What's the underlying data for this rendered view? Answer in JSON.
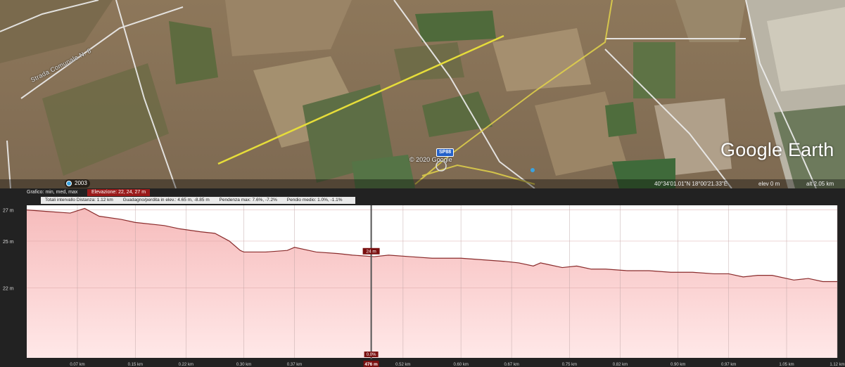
{
  "map": {
    "road_label": "Strada Comunale N. 8",
    "copyright": "© 2020 Google",
    "road_badge": "SP88",
    "brand": "Google Earth",
    "year_badge": "2003",
    "status": {
      "coords": "40°34'01.01\"N  18°00'21.33\"E",
      "elev": "elev    0 m",
      "alt": "alt  2.05 km"
    },
    "colors": {
      "path": "#e6dd3a",
      "roads": "#eeeeee"
    }
  },
  "profile": {
    "graph_label": "Grafico: min, med, max",
    "elevation_badge": "Elevazione: 22, 24, 27 m",
    "stats": {
      "distance": "Totali intervallo  Distanza: 1.12 km",
      "gain_loss": "Guadagno/perdita in elev.: 4.65 m, -8.85 m",
      "max_slope": "Pendenza max: 7.6%, -7.2%",
      "avg_slope": "Pendio medio: 1.0%, -1.1%"
    },
    "cursor": {
      "elevation_label": "24 m",
      "distance_label": "476 m",
      "slope_label": "0.0%",
      "distance_km": 0.476
    },
    "colors": {
      "fill_top": "#f6bcbc",
      "fill_bottom": "#ffe8e8",
      "line": "#8a2c2c",
      "badge": "#7a1010"
    }
  },
  "chart_data": {
    "type": "area",
    "title": "",
    "xlabel": "",
    "ylabel": "",
    "xlim": [
      0,
      1.12
    ],
    "ylim": [
      17.5,
      27.3
    ],
    "y_ticks": [
      {
        "value": 27,
        "label": "27 m"
      },
      {
        "value": 25,
        "label": "25 m"
      },
      {
        "value": 22,
        "label": "22 m"
      }
    ],
    "x_ticks": [
      {
        "value": 0.07,
        "label": "0.07 km"
      },
      {
        "value": 0.15,
        "label": "0.15 km"
      },
      {
        "value": 0.22,
        "label": "0.22 km"
      },
      {
        "value": 0.3,
        "label": "0.30 km"
      },
      {
        "value": 0.37,
        "label": "0.37 km"
      },
      {
        "value": 0.52,
        "label": "0.52 km"
      },
      {
        "value": 0.6,
        "label": "0.60 km"
      },
      {
        "value": 0.67,
        "label": "0.67 km"
      },
      {
        "value": 0.75,
        "label": "0.75 km"
      },
      {
        "value": 0.82,
        "label": "0.82 km"
      },
      {
        "value": 0.9,
        "label": "0.90 km"
      },
      {
        "value": 0.97,
        "label": "0.97 km"
      },
      {
        "value": 1.05,
        "label": "1.05 km"
      },
      {
        "value": 1.12,
        "label": "1.12 km"
      }
    ],
    "grid": true,
    "series": [
      {
        "x": [
          0.0,
          0.03,
          0.06,
          0.08,
          0.1,
          0.13,
          0.15,
          0.19,
          0.21,
          0.24,
          0.26,
          0.28,
          0.295,
          0.3,
          0.33,
          0.36,
          0.37,
          0.4,
          0.43,
          0.45,
          0.48,
          0.5,
          0.53,
          0.56,
          0.6,
          0.63,
          0.66,
          0.68,
          0.7,
          0.71,
          0.72,
          0.74,
          0.76,
          0.78,
          0.8,
          0.83,
          0.86,
          0.89,
          0.92,
          0.95,
          0.97,
          0.99,
          1.01,
          1.03,
          1.06,
          1.08,
          1.1,
          1.12
        ],
        "y": [
          27.0,
          26.9,
          26.8,
          27.1,
          26.6,
          26.4,
          26.2,
          26.0,
          25.8,
          25.6,
          25.5,
          25.0,
          24.4,
          24.3,
          24.3,
          24.4,
          24.6,
          24.3,
          24.2,
          24.1,
          24.0,
          24.1,
          24.0,
          23.9,
          23.9,
          23.8,
          23.7,
          23.6,
          23.4,
          23.6,
          23.5,
          23.3,
          23.4,
          23.2,
          23.2,
          23.1,
          23.1,
          23.0,
          23.0,
          22.9,
          22.9,
          22.7,
          22.8,
          22.8,
          22.5,
          22.6,
          22.4,
          22.4
        ]
      }
    ]
  }
}
